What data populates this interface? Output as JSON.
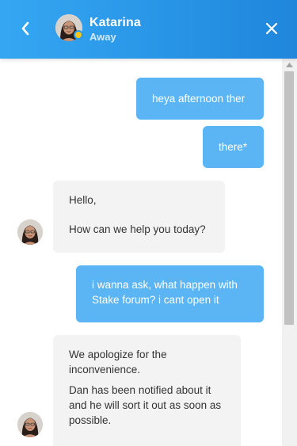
{
  "header": {
    "agent_name": "Katarina",
    "agent_status": "Away",
    "back_icon": "chevron-left-icon",
    "close_icon": "close-icon",
    "status_color": "#f5c518",
    "accent": "#2a98e8"
  },
  "messages": [
    {
      "from": "user",
      "lines": [
        "heya afternoon ther"
      ]
    },
    {
      "from": "user",
      "lines": [
        "there*"
      ]
    },
    {
      "from": "agent",
      "lines": [
        "Hello,",
        "How can we help you today?"
      ]
    },
    {
      "from": "user",
      "lines": [
        "i wanna ask, what happen with Stake forum? i cant open it"
      ]
    },
    {
      "from": "agent",
      "lines": [
        "We apologize for the inconvenience.",
        "Dan has been notified about it and he will sort it out as soon as possible."
      ]
    }
  ],
  "colors": {
    "user_bubble": "#5bb5f5",
    "agent_bubble": "#f3f3f3"
  }
}
